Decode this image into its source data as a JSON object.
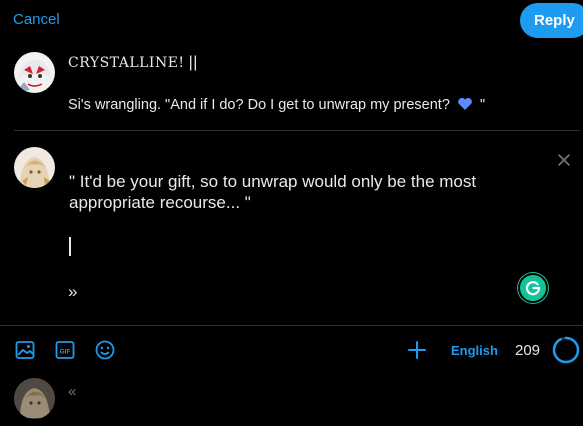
{
  "header": {
    "cancel_label": "Cancel",
    "reply_label": "Reply"
  },
  "quoted": {
    "author": "CRYSTALLINE!",
    "author_suffix": "||",
    "text_before": "Si's wrangling. \"And if I do? Do I get to unwrap my present?",
    "text_after": "\""
  },
  "composer": {
    "line1": "\" It'd be your gift, so to unwrap would only be the most appropriate recourse... \"",
    "chevron": "»"
  },
  "toolbar": {
    "language": "English",
    "char_count": "209",
    "progress_fraction": 0.92
  },
  "next_thread": {
    "chevron": "«"
  },
  "colors": {
    "accent": "#1d9bf0",
    "heart": "#5b8cff",
    "grammarly": "#15c39a"
  },
  "icons": [
    "image-icon",
    "gif-icon",
    "emoji-icon",
    "add-icon",
    "close-icon",
    "grammarly-icon"
  ]
}
